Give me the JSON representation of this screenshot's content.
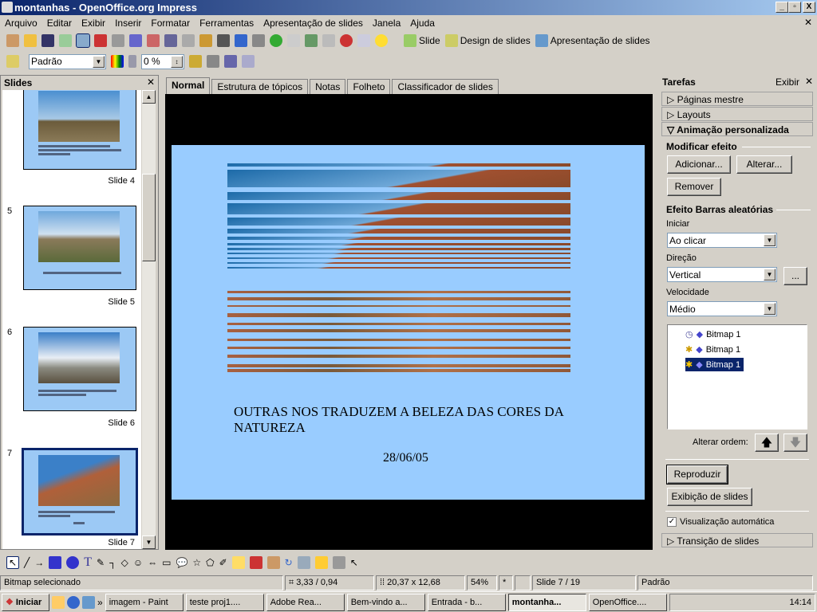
{
  "window": {
    "title": "montanhas - OpenOffice.org Impress"
  },
  "menu": [
    "Arquivo",
    "Editar",
    "Exibir",
    "Inserir",
    "Formatar",
    "Ferramentas",
    "Apresentação de slides",
    "Janela",
    "Ajuda"
  ],
  "toolbar": {
    "slide": "Slide",
    "design": "Design de slides",
    "presentation": "Apresentação de slides",
    "style_value": "Padrão",
    "transparency_value": "0 %"
  },
  "slides_pane": {
    "title": "Slides",
    "items": [
      {
        "num": "",
        "label": "Slide 4"
      },
      {
        "num": "5",
        "label": "Slide 5"
      },
      {
        "num": "6",
        "label": "Slide 6"
      },
      {
        "num": "7",
        "label": "Slide 7"
      }
    ]
  },
  "tabs": [
    "Normal",
    "Estrutura de tópicos",
    "Notas",
    "Folheto",
    "Classificador de slides"
  ],
  "slide": {
    "title": "OUTRAS NOS TRADUZEM A BELEZA DAS CORES DA NATUREZA",
    "date": "28/06/05"
  },
  "tasks": {
    "title": "Tarefas",
    "view": "Exibir",
    "sections": [
      "Páginas mestre",
      "Layouts",
      "Animação personalizada"
    ],
    "modify_group": "Modificar efeito",
    "add": "Adicionar...",
    "change": "Alterar...",
    "remove": "Remover",
    "effect_group": "Efeito Barras aleatórias",
    "start_label": "Iniciar",
    "start_value": "Ao clicar",
    "direction_label": "Direção",
    "direction_value": "Vertical",
    "more": "...",
    "speed_label": "Velocidade",
    "speed_value": "Médio",
    "animations": [
      "Bitmap 1",
      "Bitmap 1",
      "Bitmap 1"
    ],
    "reorder": "Alterar ordem:",
    "play": "Reproduzir",
    "slideshow": "Exibição de slides",
    "autopreview": "Visualização automática",
    "autopreview_checked": true,
    "transition": "Transição de slides"
  },
  "status": {
    "message": "Bitmap selecionado",
    "position": "3,33 / 0,94",
    "size": "20,37 x 12,68",
    "zoom": "54%",
    "modified": "*",
    "slide": "Slide 7 / 19",
    "layout": "Padrão"
  },
  "taskbar": {
    "start": "Iniciar",
    "items": [
      "imagem - Paint",
      "teste proj1....",
      "Adobe Rea...",
      "Bem-vindo a...",
      "Entrada - b...",
      "montanha...",
      "OpenOffice...."
    ],
    "clock": "14:14"
  },
  "colors": {
    "slide_bg": "#99ccff",
    "selection": "#0a246a"
  }
}
